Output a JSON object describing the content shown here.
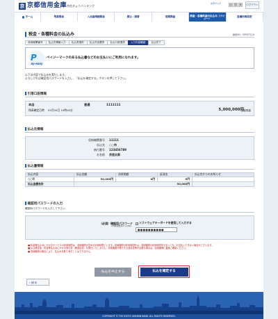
{
  "header": {
    "logo_mark": "京",
    "bank_name": "京都信用金庫",
    "service_name": "京信きょうバンキング",
    "text_size_label": "文字サイズ",
    "zoom": [
      "小",
      "中",
      "大"
    ],
    "logout": "ログアウト"
  },
  "nav": [
    "ホーム",
    "残高照会",
    "入出金明細照会",
    "振込・振替",
    "定期預金",
    "税金・各種料金の払込み（ペイジー）",
    "各種利用設定"
  ],
  "page": {
    "title": "税金・各種料金の払込み",
    "screen_id": "画面ID：BPMT510"
  },
  "steps": [
    "収納機関番号",
    "払込先情報入力",
    "払込書選択",
    "払込内容選択",
    "払込口座選択",
    "入力内容確認",
    "払込完了"
  ],
  "payeasy": {
    "logo_p": "P",
    "logo_text": "ay-easy",
    "message": "ペイジーマークのある払込書などのお支払いにご利用になれます。"
  },
  "instructions": [
    "以下の内容で払込みを実行します。",
    "よろしければ確認用パスワードを入力し、「払込を確定する」ボタンを押して下さい。"
  ],
  "account_section": {
    "heading": "引落口座情報",
    "branch": "本店",
    "type": "普通",
    "number": "1111111",
    "balance": "5,000,000円",
    "balance_label": "預金残高",
    "balance_time_label": "残高確定日時",
    "balance_time": "02月04日 10時00分"
  },
  "payee_section": {
    "heading": "払込先情報",
    "rows": [
      {
        "key": "収納機関番号",
        "value": "11111"
      },
      {
        "key": "払込先",
        "value": "○○市"
      },
      {
        "key": "納付番号",
        "value": "123456789"
      },
      {
        "key": "お名前",
        "value": "京信太郎"
      }
    ]
  },
  "bill_section": {
    "heading": "払込書情報",
    "columns": [
      "払込内容",
      "払込金額",
      "消費税額",
      "延滞金",
      "払込先からのお知らせ"
    ],
    "rows": [
      {
        "content": "○○税",
        "amount": "50,000円",
        "tax": "0円",
        "late": "0円",
        "notice": ""
      }
    ],
    "total_label": "払込金額合計",
    "total": "50,000円"
  },
  "password_section": {
    "heading": "確認用パスワードの入力",
    "prompt": "確認用パスワードを入力して下さい。",
    "label": "（必須）確認用パスワード",
    "hint": "（半角英数字6～12桁）",
    "software_keyboard": "ソフトウェアキーボードを使用して入力する",
    "software_keyboard_check": "✓",
    "value": "●●●●●●●●●●"
  },
  "notes": [
    "■ 料金等払込みにかかるサービスの利用時間は、収納機関が定める利用時間とします。収納機関の利用時間外は、収納機関の利用時間内であっても、お支払いできない場合がございます。",
    "■ 払込確定後、料金等払込みにかかる受付書（確認証書）を発行いたしません。収納機関が発行する領収書等が必要な場合は、収納機関に直接ご確認ください。",
    "■ 収納機関の都合により、払込みを取り消すことはできません。"
  ],
  "buttons": {
    "cancel": "払込を中止する",
    "confirm": "払込を確定する",
    "back": "戻る"
  },
  "footer": {
    "copyright": "COPYRIGHT © THE KYOTO SHINKIN BANK. ALL RIGHTS RESERVED."
  }
}
